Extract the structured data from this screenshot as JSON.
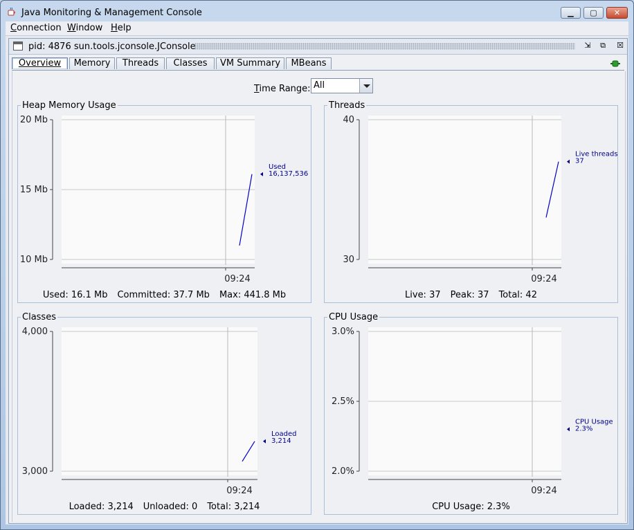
{
  "window": {
    "title": "Java Monitoring & Management Console"
  },
  "menubar": {
    "items": [
      "Connection",
      "Window",
      "Help"
    ]
  },
  "internal_frame": {
    "title": "pid: 4876 sun.tools.jconsole.JConsole"
  },
  "tabs": [
    "Overview",
    "Memory",
    "Threads",
    "Classes",
    "VM Summary",
    "MBeans"
  ],
  "active_tab": "Overview",
  "time_range": {
    "label": "Time Range:",
    "value": "All"
  },
  "charts": {
    "heap": {
      "title": "Heap Memory Usage",
      "yticks": [
        "20 Mb",
        "15 Mb",
        "10 Mb"
      ],
      "xtick": "09:24",
      "legend_name": "Used",
      "legend_value": "16,137,536",
      "footer": [
        "Used: 16.1 Mb",
        "Committed: 37.7 Mb",
        "Max: 441.8 Mb"
      ]
    },
    "threads": {
      "title": "Threads",
      "yticks": [
        "40",
        "30"
      ],
      "xtick": "09:24",
      "legend_name": "Live threads",
      "legend_value": "37",
      "footer": [
        "Live: 37",
        "Peak: 37",
        "Total: 42"
      ]
    },
    "classes": {
      "title": "Classes",
      "yticks": [
        "4,000",
        "3,000"
      ],
      "xtick": "09:24",
      "legend_name": "Loaded",
      "legend_value": "3,214",
      "footer": [
        "Loaded: 3,214",
        "Unloaded: 0",
        "Total: 3,214"
      ]
    },
    "cpu": {
      "title": "CPU Usage",
      "yticks": [
        "3.0%",
        "2.5%",
        "2.0%"
      ],
      "xtick": "09:24",
      "legend_name": "CPU Usage",
      "legend_value": "2.3%",
      "footer": [
        "CPU Usage: 2.3%"
      ]
    }
  },
  "chart_data": [
    {
      "type": "line",
      "title": "Heap Memory Usage",
      "ylabel": "",
      "xlabel": "",
      "x": [
        "09:24"
      ],
      "series": [
        {
          "name": "Used",
          "values": [
            11.0,
            16.1
          ]
        }
      ],
      "ylim": [
        10,
        20
      ],
      "ylim_unit": "Mb",
      "grid": true
    },
    {
      "type": "line",
      "title": "Threads",
      "x": [
        "09:24"
      ],
      "series": [
        {
          "name": "Live threads",
          "values": [
            33,
            37
          ]
        }
      ],
      "ylim": [
        30,
        40
      ],
      "grid": true
    },
    {
      "type": "line",
      "title": "Classes",
      "x": [
        "09:24"
      ],
      "series": [
        {
          "name": "Loaded",
          "values": [
            3070,
            3214
          ]
        }
      ],
      "ylim": [
        3000,
        4000
      ],
      "grid": true
    },
    {
      "type": "line",
      "title": "CPU Usage",
      "x": [
        "09:24"
      ],
      "series": [
        {
          "name": "CPU Usage",
          "values": [
            2.3
          ]
        }
      ],
      "ylim": [
        2.0,
        3.0
      ],
      "grid": true
    }
  ],
  "colors": {
    "series_line": "#0000cc",
    "legend_text": "#00008b",
    "grid": "#c8c8c8",
    "plot_bg": "#fafafa"
  }
}
